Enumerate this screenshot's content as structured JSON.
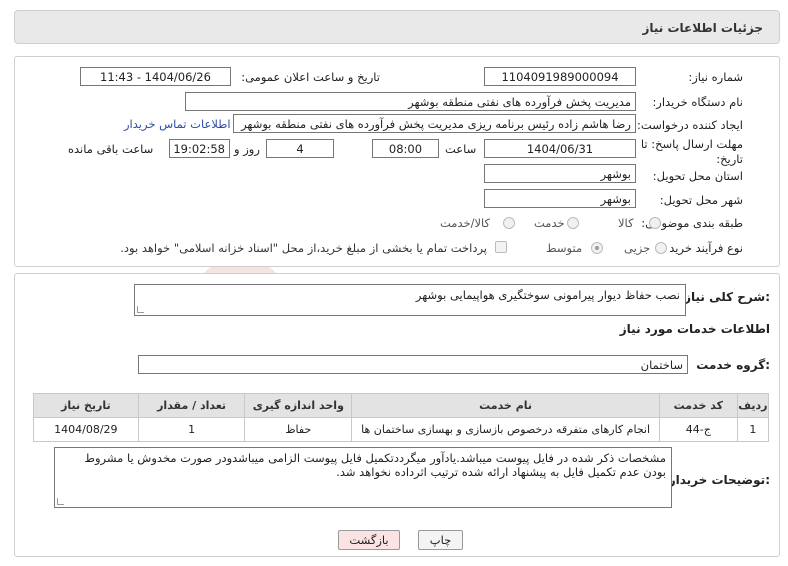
{
  "header": {
    "title": "جزئیات اطلاعات نیاز"
  },
  "fields": {
    "need_number_label": "شماره نیاز:",
    "need_number": "1104091989000094",
    "announce_label": "تاریخ و ساعت اعلان عمومی:",
    "announce_value": "1404/06/26 - 11:43",
    "buyer_org_label": "نام دستگاه خریدار:",
    "buyer_org": "مدیریت پخش فرآورده های نفتی منطقه بوشهر",
    "requester_label": "ایجاد کننده درخواست:",
    "requester": "رضا هاشم زاده رئیس برنامه ریزی مدیریت پخش فرآورده های نفتی منطقه بوشهر",
    "contact_link": "اطلاعات تماس خریدار",
    "deadline_label_1": "مهلت ارسال پاسخ: تا",
    "deadline_label_2": "تاریخ:",
    "deadline_date": "1404/06/31",
    "time_label": "ساعت",
    "deadline_time": "08:00",
    "days_value": "4",
    "days_label": "روز و",
    "remaining_time": "19:02:58",
    "remaining_label": "ساعت باقی مانده",
    "province_label": "استان محل تحویل:",
    "province": "بوشهر",
    "city_label": "شهر محل تحویل:",
    "city": "بوشهر",
    "category_label": "طبقه بندی موضوعی:",
    "category_options": [
      "کالا",
      "خدمت",
      "کالا/خدمت"
    ],
    "purchase_type_label": "نوع فرآیند خرید :",
    "purchase_options": [
      "جزیی",
      "متوسط"
    ],
    "payment_note": "پرداخت تمام یا بخشی از مبلغ خرید،از محل \"اسناد خزانه اسلامی\" خواهد بود."
  },
  "details": {
    "summary_label": "شرح کلی نیاز:",
    "summary": "نصب حفاظ دیوار پیرامونی سوختگیری هواپیمایی بوشهر",
    "services_heading": "اطلاعات خدمات مورد نیاز",
    "service_group_label": "گروه خدمت:",
    "service_group": "ساختمان",
    "table": {
      "headers": [
        "ردیف",
        "کد خدمت",
        "نام خدمت",
        "واحد اندازه گیری",
        "تعداد / مقدار",
        "تاریخ نیاز"
      ],
      "rows": [
        [
          "1",
          "ج-44",
          "انجام کارهای متفرقه درخصوص بازسازی و بهسازی ساختمان ها",
          "حفاظ",
          "1",
          "1404/08/29"
        ]
      ]
    },
    "buyer_notes_label": "توضیحات خریدار:",
    "buyer_notes": "مشخصات ذکر شده در فایل پیوست میباشد.یادآور میگرددتکمیل فایل پیوست الزامی میباشدودر صورت مخدوش یا مشروط بودن عدم تکمیل فایل به پیشنهاد ارائه شده ترتیب اثرداده نخواهد شد."
  },
  "buttons": {
    "print": "چاپ",
    "back": "بازگشت"
  },
  "watermark": {
    "text": "AriaTender.net"
  },
  "colors": {
    "link": "#2a4fa5",
    "back_button": "#fbe3e3",
    "watermark": "#c0392b"
  }
}
